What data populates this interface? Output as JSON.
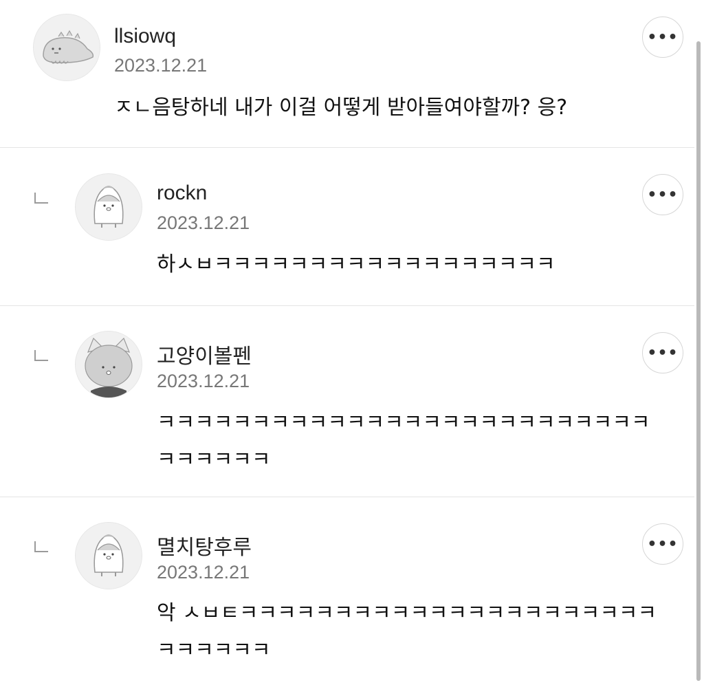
{
  "comments": [
    {
      "username": "llsiowq",
      "date": "2023.12.21",
      "text": "ㅈㄴ음탕하네 내가 이걸 어떻게 받아들여야할까? 응?",
      "avatar_icon": "dinosaur-avatar-icon",
      "more_label": "•••",
      "is_reply": false
    },
    {
      "username": "rockn",
      "date": "2023.12.21",
      "text": "하ㅅㅂㅋㅋㅋㅋㅋㅋㅋㅋㅋㅋㅋㅋㅋㅋㅋㅋㅋㅋ",
      "avatar_icon": "penguin-avatar-icon",
      "more_label": "•••",
      "is_reply": true
    },
    {
      "username": "고양이볼펜",
      "date": "2023.12.21",
      "text": "ㅋㅋㅋㅋㅋㅋㅋㅋㅋㅋㅋㅋㅋㅋㅋㅋㅋㅋㅋㅋㅋㅋㅋㅋㅋㅋㅋㅋㅋㅋㅋㅋ",
      "avatar_icon": "cat-avatar-icon",
      "more_label": "•••",
      "is_reply": true
    },
    {
      "username": "멸치탕후루",
      "date": "2023.12.21",
      "text": "악 ㅅㅂㅌㅋㅋㅋㅋㅋㅋㅋㅋㅋㅋㅋㅋㅋㅋㅋㅋㅋㅋㅋㅋㅋㅋㅋㅋㅋㅋㅋㅋ",
      "avatar_icon": "penguin-avatar-icon",
      "more_label": "•••",
      "is_reply": true
    }
  ]
}
